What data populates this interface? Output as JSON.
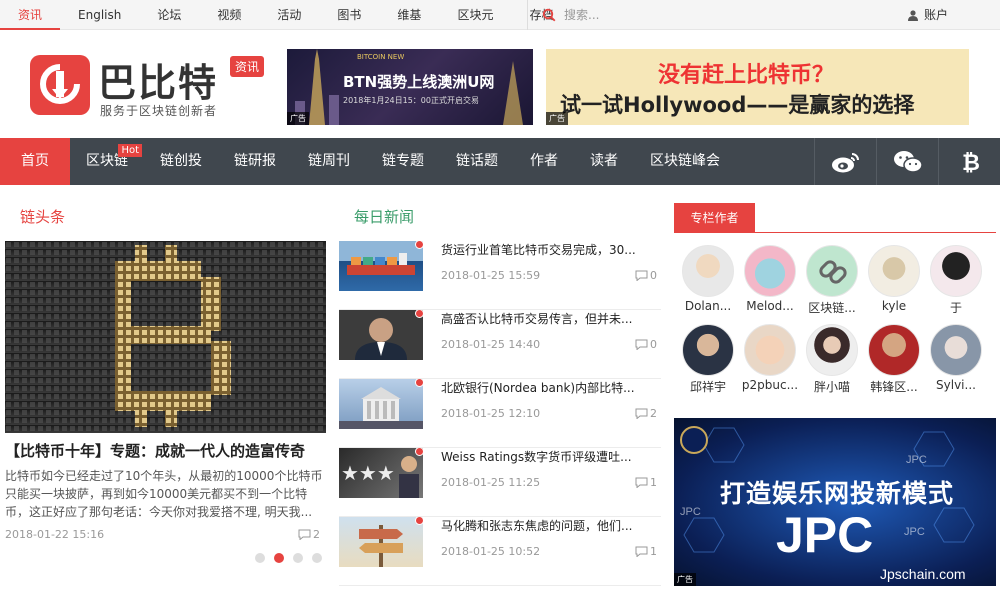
{
  "topnav": {
    "items": [
      {
        "label": "资讯",
        "active": true
      },
      {
        "label": "English"
      },
      {
        "label": "论坛"
      },
      {
        "label": "视频"
      },
      {
        "label": "活动"
      },
      {
        "label": "图书"
      },
      {
        "label": "维基"
      },
      {
        "label": "区块元"
      },
      {
        "label": "存档"
      }
    ],
    "search_placeholder": "搜索...",
    "account": "账户"
  },
  "logo": {
    "name": "巴比特",
    "badge": "资讯",
    "slogan": "服务于区块链创新者"
  },
  "ads": {
    "tag": "广告",
    "ad1": {
      "brand": "BITCOIN NEW",
      "title": "BTN强势上线澳洲U网",
      "subtitle": "2018年1月24日15：00正式开启交易"
    },
    "ad2": {
      "line1": "没有赶上比特币？",
      "line2": "试一试Hollywood——是赢家的选择"
    },
    "ad3": {
      "title": "打造娱乐网投新模式",
      "big": "JPC",
      "url": "Jpschain.com",
      "small": "JPC"
    }
  },
  "mainnav": {
    "items": [
      "首页",
      "区块链",
      "链创投",
      "链研报",
      "链周刊",
      "链专题",
      "链话题",
      "作者",
      "读者",
      "区块链峰会"
    ],
    "hot": "Hot"
  },
  "headline": {
    "section": "链头条",
    "title": "【比特币十年】专题：成就一代人的造富传奇",
    "desc": "比特币如今已经走过了10个年头，从最初的10000个比特币只能买一块披萨，再到如今10000美元都买不到一个比特币，这正好应了那句老话：今天你对我爱搭不理, 明天我...",
    "time": "2018-01-22 15:16",
    "comments": "2"
  },
  "daily": {
    "section": "每日新闻",
    "items": [
      {
        "title": "货运行业首笔比特币交易完成，30...",
        "time": "2018-01-25 15:59",
        "comments": "0"
      },
      {
        "title": "高盛否认比特币交易传言，但并未...",
        "time": "2018-01-25 14:40",
        "comments": "0"
      },
      {
        "title": "北欧银行(Nordea bank)内部比特...",
        "time": "2018-01-25 12:10",
        "comments": "2"
      },
      {
        "title": "Weiss Ratings数字货币评级遭吐...",
        "time": "2018-01-25 11:25",
        "comments": "1"
      },
      {
        "title": "马化腾和张志东焦虑的问题，他们...",
        "time": "2018-01-25 10:52",
        "comments": "1"
      }
    ]
  },
  "columnists": {
    "tab": "专栏作者",
    "authors": [
      "Dolan...",
      "Melod...",
      "区块链...",
      "kyle",
      "于",
      "邱祥宇",
      "p2pbuc...",
      "胖小喵",
      "韩锋区...",
      "Sylvi..."
    ]
  },
  "colors": {
    "accent": "#e64340",
    "nav": "#40474e",
    "green": "#3a9c6a"
  }
}
